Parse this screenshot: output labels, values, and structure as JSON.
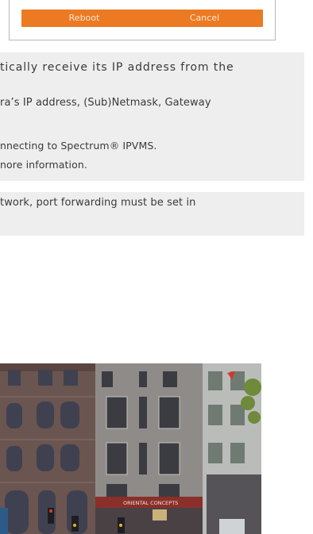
{
  "dialog": {
    "reboot_label": "Reboot",
    "cancel_label": "Cancel"
  },
  "note1": {
    "line1": "tically receive its IP address from the",
    "line2": "ra’s IP address, (Sub)Netmask, Gateway",
    "line3": "nnecting to Spectrum® IPVMS.",
    "line4": "nore information."
  },
  "note2": {
    "line1": "twork, port forwarding must be set in"
  },
  "camera_view": {
    "shop_sign": "ORIENTAL CONCEPTS"
  },
  "colors": {
    "accent": "#ec7a22",
    "note_bg": "#eeeeee",
    "dialog_border": "#b9b9b9"
  }
}
